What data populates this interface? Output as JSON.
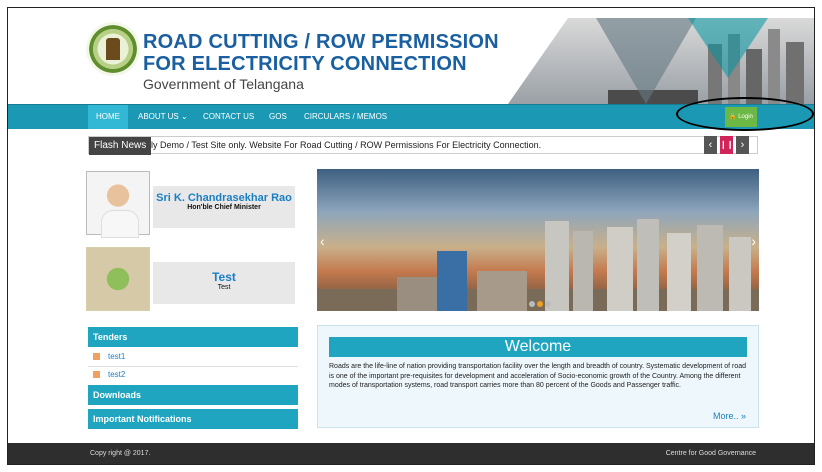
{
  "header": {
    "title_line1": "ROAD CUTTING / ROW PERMISSION",
    "title_line2": "FOR ELECTRICITY CONNECTION",
    "subtitle": "Government of Telangana"
  },
  "nav": {
    "items": [
      {
        "label": "HOME",
        "active": true
      },
      {
        "label": "ABOUT US ⌄"
      },
      {
        "label": "CONTACT US"
      },
      {
        "label": "GOS"
      },
      {
        "label": "CIRCULARS / MEMOS"
      }
    ],
    "login_label": "🔒 Login"
  },
  "flash": {
    "label": "Flash News",
    "text": "ly Demo / Test Site only.  Website For Road Cutting / ROW Permissions For Electricity Connection.",
    "prev_icon": "‹",
    "pause_icon": "❙❙",
    "next_icon": "›"
  },
  "profiles": [
    {
      "name": "Sri K. Chandrasekhar Rao",
      "role": "Hon'ble Chief Minister"
    },
    {
      "name": "Test",
      "role": "Test"
    }
  ],
  "slider": {
    "prev": "‹",
    "next": "›"
  },
  "tenders": {
    "heading": "Tenders",
    "items": [
      "test1",
      "test2"
    ]
  },
  "downloads": {
    "heading": "Downloads"
  },
  "notifications": {
    "heading": "Important Notifications"
  },
  "welcome": {
    "title": "Welcome",
    "text": "Roads are the life-line of nation providing transportation facility over the length and breadth of country. Systematic development of road is one of the important pre-requisites for development and acceleration of Socio-economic growth of the Country. Among the different modes of transportation systems, road transport carries more than 80 percent of the Goods and Passenger traffic.",
    "more": "More.. »"
  },
  "footer": {
    "left": "Copy right @ 2017.",
    "right": "Centre for Good Governance"
  },
  "colors": {
    "brand_blue": "#1a5fa0",
    "nav_teal": "#1b99b4",
    "login_green": "#6cb844"
  }
}
